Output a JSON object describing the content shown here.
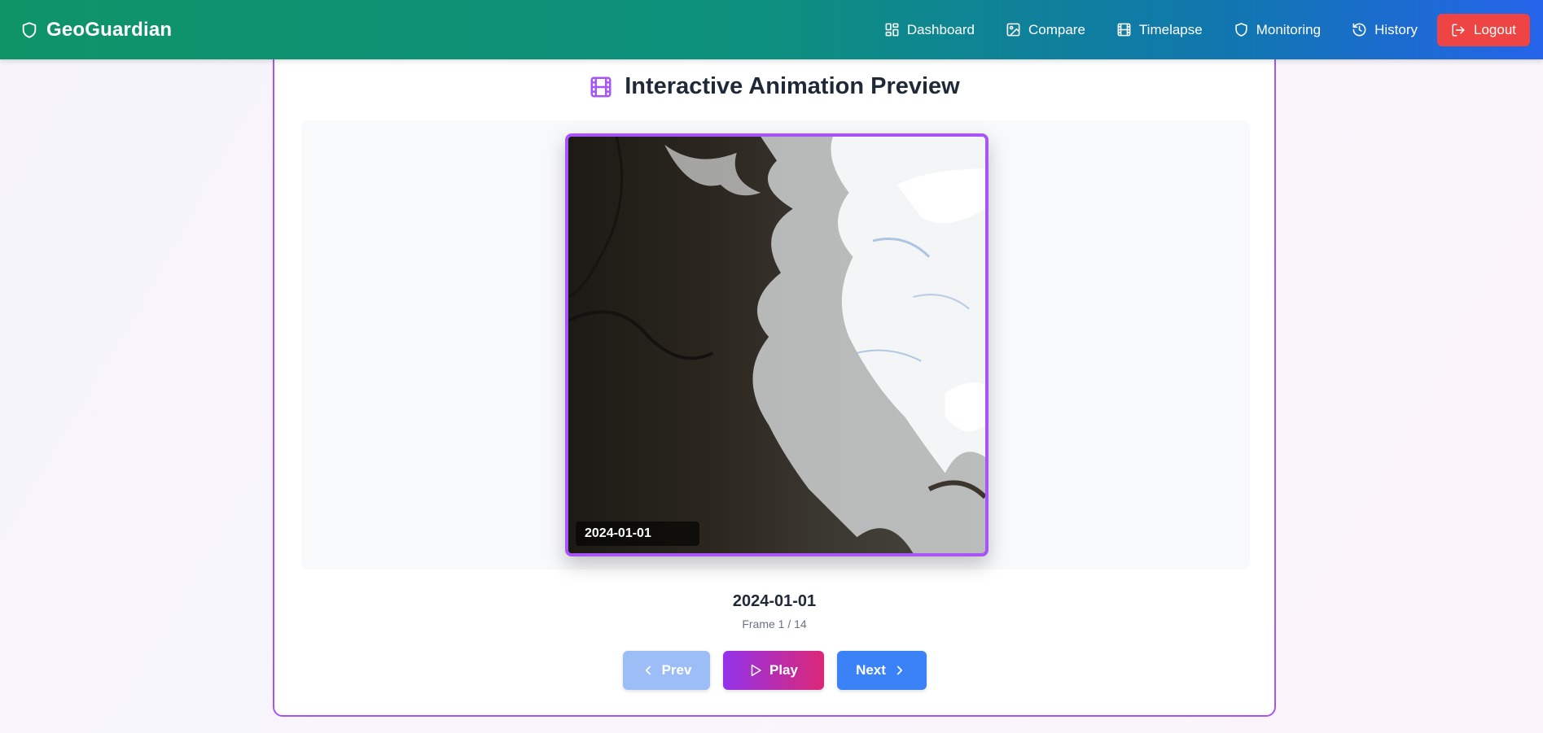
{
  "app": {
    "title": "GeoGuardian",
    "brand_icon": "shield-icon"
  },
  "nav": {
    "items": [
      {
        "label": "Dashboard",
        "icon": "dashboard-icon"
      },
      {
        "label": "Compare",
        "icon": "image-icon"
      },
      {
        "label": "Timelapse",
        "icon": "film-icon"
      },
      {
        "label": "Monitoring",
        "icon": "shield-icon"
      },
      {
        "label": "History",
        "icon": "history-icon"
      }
    ],
    "logout_label": "Logout",
    "logout_color": "#ef4444"
  },
  "preview": {
    "title": "Interactive Animation Preview",
    "title_icon": "film-icon",
    "overlay_date": "2024-01-01",
    "current_date": "2024-01-01",
    "frame_counter": "Frame 1 / 14",
    "accent_color": "#a855f7"
  },
  "controls": {
    "prev_label": "Prev",
    "play_label": "Play",
    "next_label": "Next",
    "prev_disabled": true
  }
}
